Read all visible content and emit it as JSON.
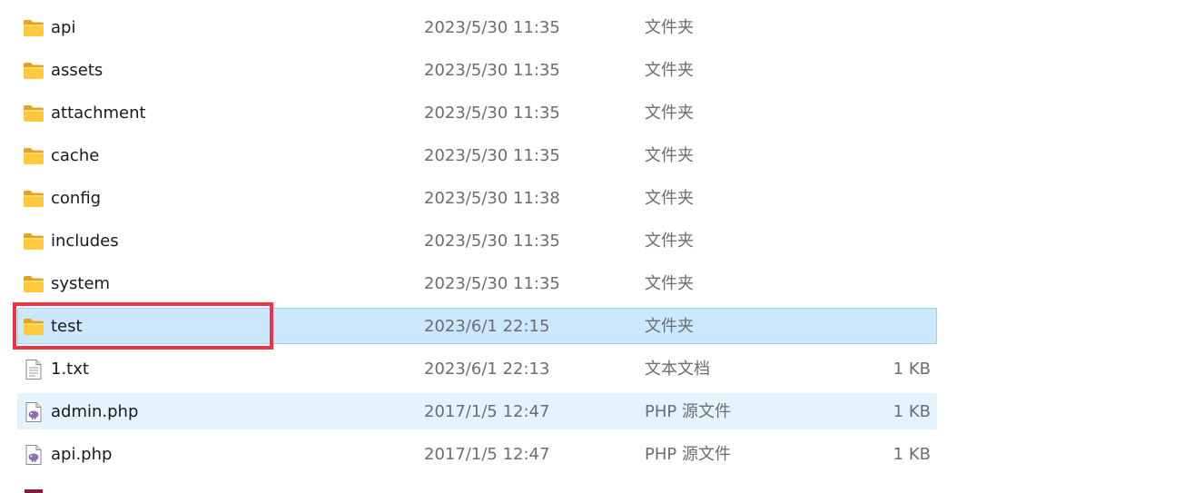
{
  "files": [
    {
      "name": "api",
      "date": "2023/5/30 11:35",
      "type": "文件夹",
      "size": "",
      "icon": "folder-icon",
      "state": ""
    },
    {
      "name": "assets",
      "date": "2023/5/30 11:35",
      "type": "文件夹",
      "size": "",
      "icon": "folder-icon",
      "state": ""
    },
    {
      "name": "attachment",
      "date": "2023/5/30 11:35",
      "type": "文件夹",
      "size": "",
      "icon": "folder-icon",
      "state": ""
    },
    {
      "name": "cache",
      "date": "2023/5/30 11:35",
      "type": "文件夹",
      "size": "",
      "icon": "folder-icon",
      "state": ""
    },
    {
      "name": "config",
      "date": "2023/5/30 11:38",
      "type": "文件夹",
      "size": "",
      "icon": "folder-icon",
      "state": ""
    },
    {
      "name": "includes",
      "date": "2023/5/30 11:35",
      "type": "文件夹",
      "size": "",
      "icon": "folder-icon",
      "state": ""
    },
    {
      "name": "system",
      "date": "2023/5/30 11:35",
      "type": "文件夹",
      "size": "",
      "icon": "folder-icon",
      "state": ""
    },
    {
      "name": "test",
      "date": "2023/6/1 22:15",
      "type": "文件夹",
      "size": "",
      "icon": "folder-icon",
      "state": "selected"
    },
    {
      "name": "1.txt",
      "date": "2023/6/1 22:13",
      "type": "文本文档",
      "size": "1 KB",
      "icon": "text-file-icon",
      "state": ""
    },
    {
      "name": "admin.php",
      "date": "2017/1/5 12:47",
      "type": "PHP 源文件",
      "size": "1 KB",
      "icon": "php-file-icon",
      "state": "hover"
    },
    {
      "name": "api.php",
      "date": "2017/1/5 12:47",
      "type": "PHP 源文件",
      "size": "1 KB",
      "icon": "php-file-icon",
      "state": ""
    },
    {
      "name": "",
      "date": "",
      "type": "",
      "size": "",
      "icon": "rar-archive-icon",
      "state": ""
    }
  ],
  "colors": {
    "selected_bg": "#cce8ff",
    "selected_border": "#99d1ff",
    "hover_bg": "#e5f3ff",
    "highlight_box": "#ef3340",
    "folder": "#ffc83d",
    "php": "#8a6fb3"
  }
}
